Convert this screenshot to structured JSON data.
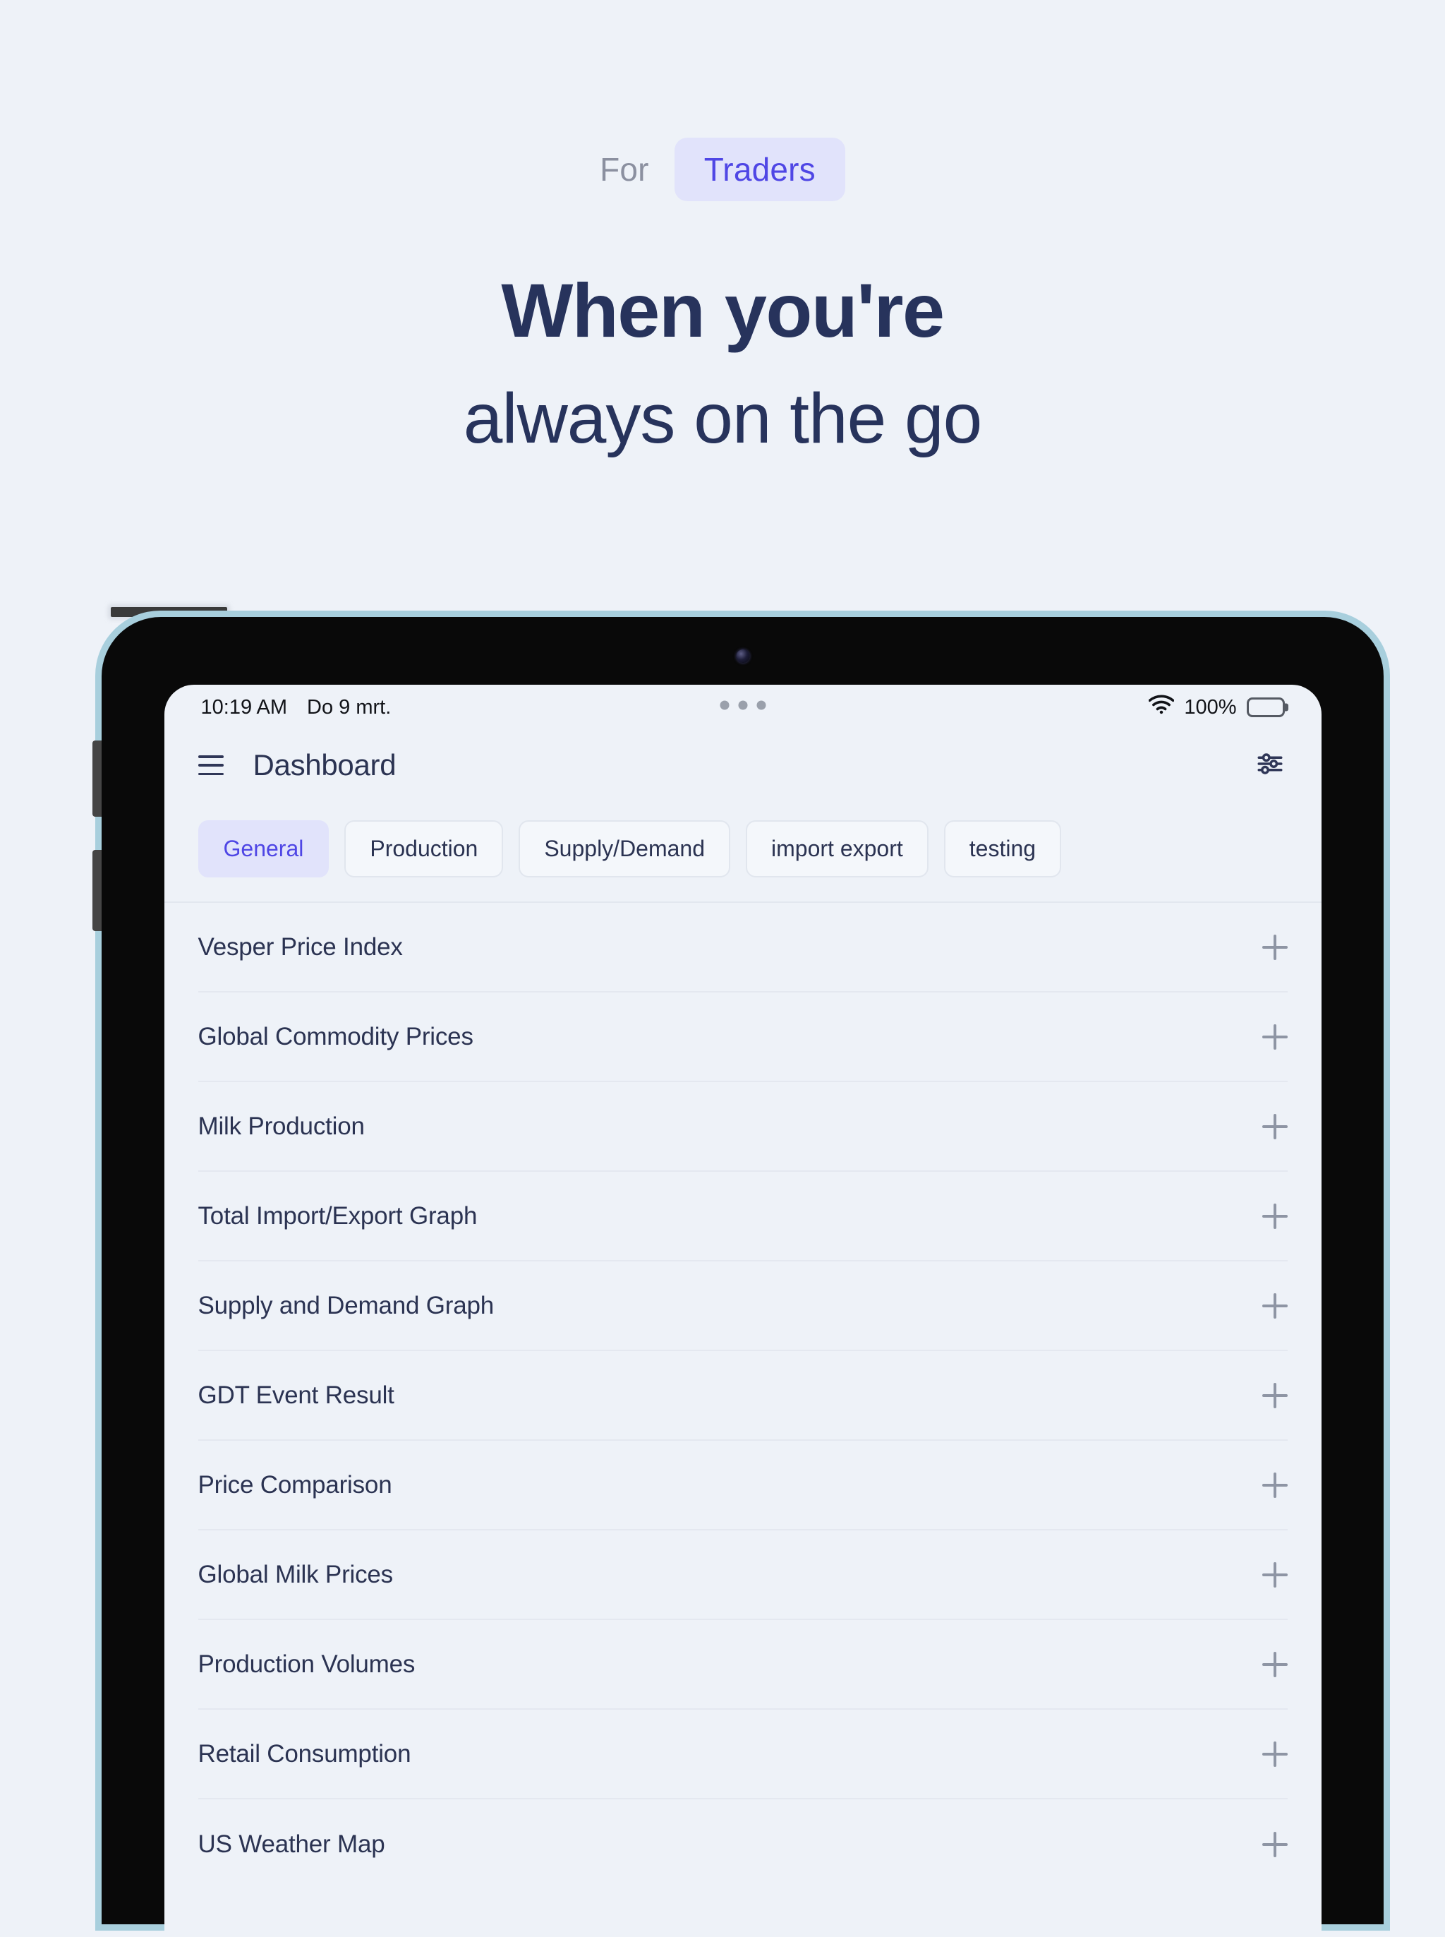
{
  "hero": {
    "eyebrow_prefix": "For",
    "eyebrow_tag": "Traders",
    "headline_line1": "When you're",
    "headline_line2": "always on the go",
    "text_color": "#27335c",
    "accent_color": "#4f46e5",
    "accent_bg": "#e1e3fb",
    "page_bg": "#eef2f8"
  },
  "device": {
    "bezel_color": "#a8cfdd",
    "frame_color": "#090909"
  },
  "statusbar": {
    "time": "10:19 AM",
    "date": "Do 9 mrt.",
    "battery_percent": "100%",
    "wifi_icon": "wifi-icon",
    "battery_icon": "battery-full-icon",
    "dots_icon": "three-dots-icon"
  },
  "appbar": {
    "menu_icon": "hamburger-menu-icon",
    "title": "Dashboard",
    "settings_icon": "tune-sliders-icon"
  },
  "tabs": [
    {
      "label": "General",
      "active": true
    },
    {
      "label": "Production",
      "active": false
    },
    {
      "label": "Supply/Demand",
      "active": false
    },
    {
      "label": "import export",
      "active": false
    },
    {
      "label": "testing",
      "active": false
    }
  ],
  "list": {
    "add_icon": "plus-icon",
    "items": [
      {
        "label": "Vesper Price Index"
      },
      {
        "label": "Global Commodity Prices"
      },
      {
        "label": "Milk Production"
      },
      {
        "label": "Total Import/Export Graph"
      },
      {
        "label": "Supply and Demand Graph"
      },
      {
        "label": "GDT Event Result"
      },
      {
        "label": "Price Comparison"
      },
      {
        "label": "Global Milk Prices"
      },
      {
        "label": "Production Volumes"
      },
      {
        "label": "Retail Consumption"
      },
      {
        "label": "US Weather Map"
      }
    ]
  }
}
